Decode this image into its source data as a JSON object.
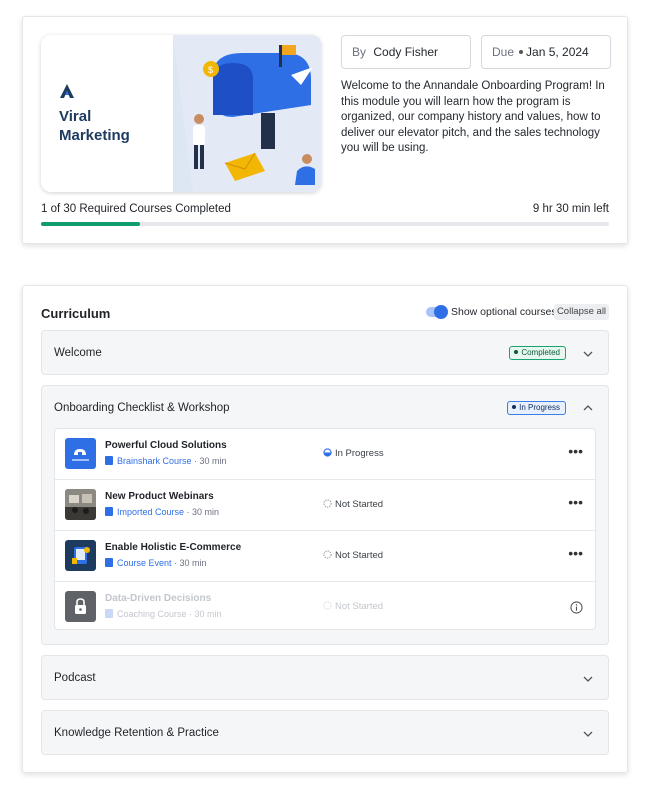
{
  "course": {
    "card_title_line1": "Viral",
    "card_title_line2": "Marketing",
    "author_label": "By",
    "author_name": "Cody Fisher",
    "due_label": "Due",
    "due_date": "Jan 5, 2024",
    "description": "Welcome to the Annandale Onboarding Program! In this module you will learn how the program is organized, our company history and values, how to deliver our elevator pitch, and the sales technology you will be using.",
    "progress_text": "1 of 30 Required Courses Completed",
    "progress_fraction": 0.175,
    "time_left": "9 hr 30 min left",
    "colors": {
      "progress": "#0f9d6b",
      "title": "#1d3a5f",
      "accent": "#2f6fe6"
    }
  },
  "curriculum": {
    "title": "Curriculum",
    "optional_toggle_label": "Show optional courses",
    "optional_toggle_on": true,
    "collapse_label": "Collapse all",
    "sections": [
      {
        "title": "Welcome",
        "badge": "Completed",
        "expanded": false
      },
      {
        "title": "Onboarding Checklist & Workshop",
        "badge": "In Progress",
        "expanded": true,
        "items": [
          {
            "name": "Powerful Cloud Solutions",
            "type": "Brainshark Course",
            "duration": "30 min",
            "status": "In Progress",
            "thumb_icon": "cloud-thumbnail"
          },
          {
            "name": "New Product Webinars",
            "type": "Imported Course",
            "duration": "30 min",
            "status": "Not Started",
            "thumb_icon": "webinar-photo-thumbnail"
          },
          {
            "name": "Enable Holistic E-Commerce",
            "type": "Course Event",
            "duration": "30 min",
            "status": "Not Started",
            "thumb_icon": "ecommerce-thumbnail"
          },
          {
            "name": "Data-Driven Decisions",
            "type": "Coaching Course",
            "duration": "30 min",
            "status": "Not Started",
            "thumb_icon": "lock-icon",
            "locked": true
          }
        ]
      },
      {
        "title": "Podcast",
        "expanded": false
      },
      {
        "title": "Knowledge Retention & Practice",
        "expanded": false
      }
    ]
  }
}
